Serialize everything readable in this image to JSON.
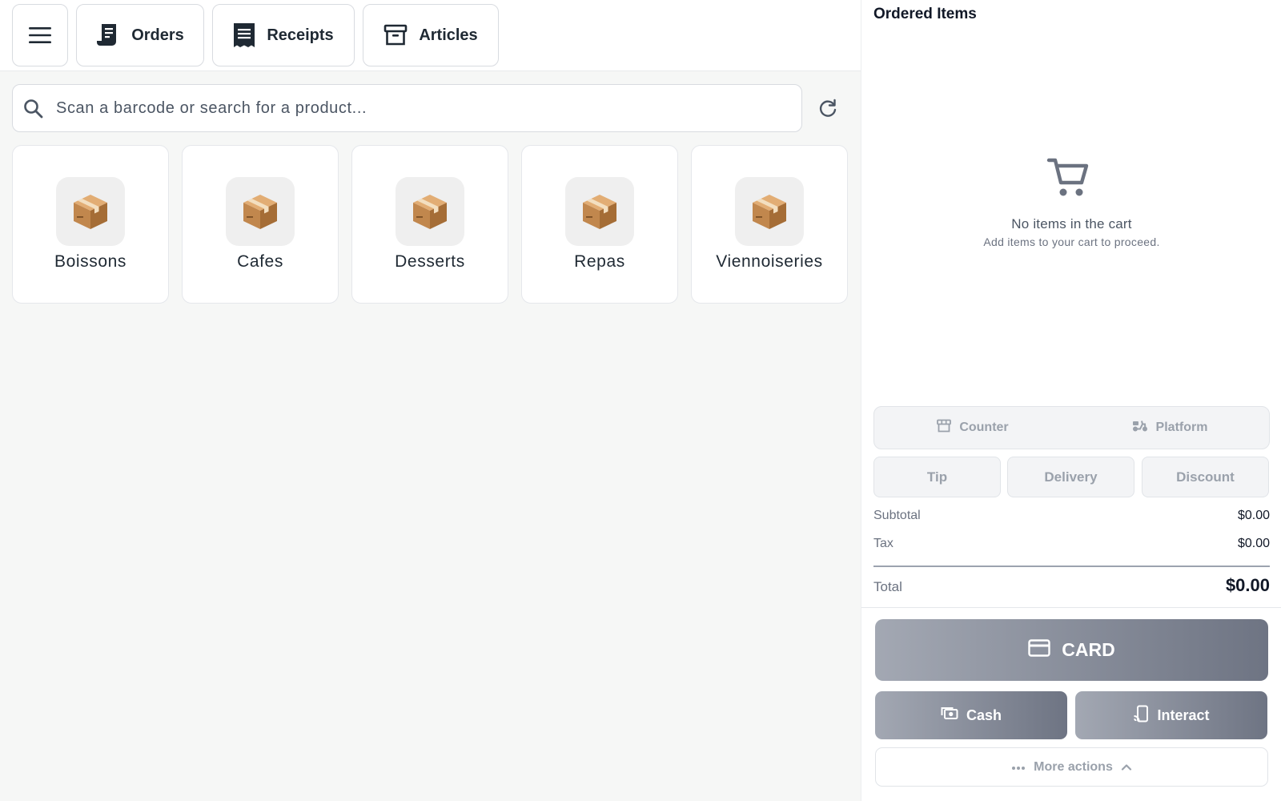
{
  "toolbar": {
    "menu_icon": "hamburger-icon",
    "orders_label": "Orders",
    "receipts_label": "Receipts",
    "articles_label": "Articles"
  },
  "search": {
    "placeholder": "Scan a barcode or search for a product...",
    "value": ""
  },
  "categories": [
    {
      "label": "Boissons",
      "icon": "package-icon"
    },
    {
      "label": "Cafes",
      "icon": "package-icon"
    },
    {
      "label": "Desserts",
      "icon": "package-icon"
    },
    {
      "label": "Repas",
      "icon": "package-icon"
    },
    {
      "label": "Viennoiseries",
      "icon": "package-icon"
    }
  ],
  "cart": {
    "title": "Ordered Items",
    "empty_title": "No items in the cart",
    "empty_subtitle": "Add items to your cart to proceed.",
    "order_type": {
      "counter": "Counter",
      "platform": "Platform"
    },
    "adjustments": {
      "tip": "Tip",
      "delivery": "Delivery",
      "discount": "Discount"
    },
    "summary": {
      "subtotal_label": "Subtotal",
      "subtotal_value": "$0.00",
      "tax_label": "Tax",
      "tax_value": "$0.00",
      "total_label": "Total",
      "total_value": "$0.00"
    },
    "payment": {
      "card": "CARD",
      "cash": "Cash",
      "interact": "Interact"
    },
    "more_actions": "More actions"
  },
  "colors": {
    "pay_gradient_start": "#a3a8b3",
    "pay_gradient_end": "#6e7483",
    "muted_text": "#9aa1ab",
    "background": "#f6f7f6"
  }
}
